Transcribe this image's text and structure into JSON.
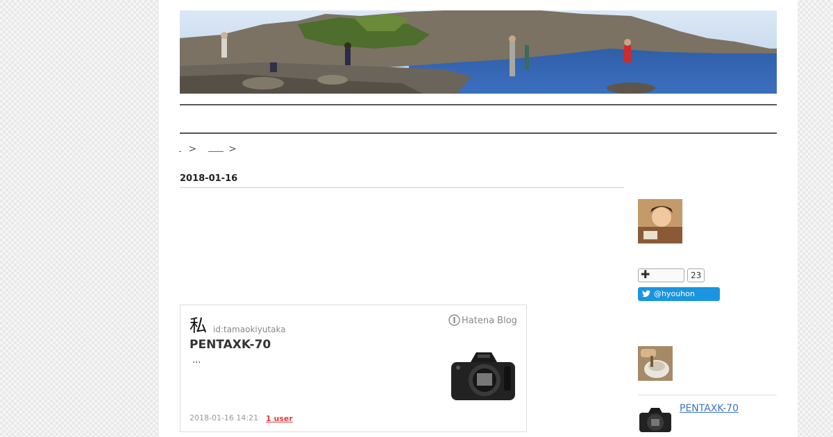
{
  "breadcrumb": {
    "separator_1": ">",
    "separator_2": ">"
  },
  "entry": {
    "date": "2018-01-16"
  },
  "embed_card": {
    "author_glyph": "私",
    "author_id": "id:tamaokiyutaka",
    "service_name": "Hatena Blog",
    "title": "PENTAXK-70",
    "excerpt": "...",
    "timestamp": "2018-01-16 14:21",
    "bookmark_count": "1 user",
    "thumbnail_icon": "camera-icon"
  },
  "sidebar": {
    "follow_icon": "plus-icon",
    "follower_count": "23",
    "twitter_handle": "@hyouhon",
    "related_entry_title": "PENTAXK-70"
  },
  "colors": {
    "link": "#3b73c6",
    "twitter_blue": "#1b95e0",
    "bookmark_red": "#e03b3b"
  }
}
